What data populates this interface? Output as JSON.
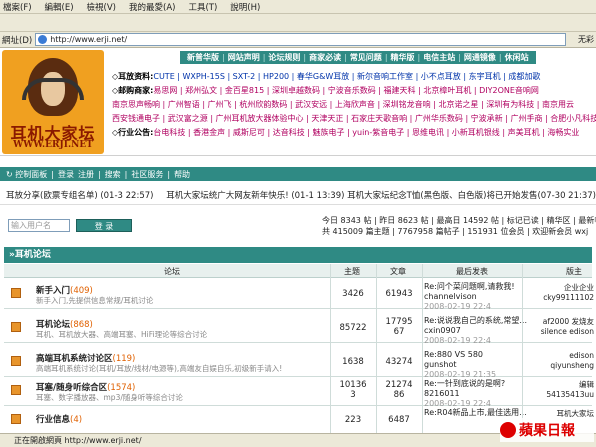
{
  "browser": {
    "menu": [
      "檔案(F)",
      "編輯(E)",
      "檢視(V)",
      "我的最愛(A)",
      "工具(T)",
      "說明(H)"
    ],
    "address_label": "網址(D)",
    "address_value": "http://www.erji.net/",
    "address_right": "无彩",
    "status_text": "正在開啟網頁 http://www.erji.net/"
  },
  "logo": {
    "title": "耳机大家坛",
    "url": "WWW.ERJI.NET"
  },
  "top_nav": [
    "新普华版",
    "网站声明",
    "论坛规则",
    "商家必读",
    "常见问题",
    "精华版",
    "电信主站",
    "网通镜像",
    "休闲站"
  ],
  "links_rows": [
    {
      "tag": "◇耳放资料:",
      "text": "CUTE | WXPH-15S | SXT-2 | HP200 | 春华G&W耳放 | 新尔音响工作室 | 小不点耳放 | 东宇耳机 | 成都加歌"
    },
    {
      "tag": "◇邮购商家:",
      "text": "易思网 | 郑州弘文 | 金百星815 | 深圳卓越数码 | 宁波音乐数码 | 福建天科 | 北京樟叶耳机 | DIY2ONE音响网"
    },
    {
      "tag": "",
      "text": "南京思声畅响 | 广州智语 | 广州飞 | 杭州欣韵数码 | 武汉安远 | 上海欣声音 | 深圳铭龙音响 | 北京诺之星 | 深圳有为科技 | 南京用云"
    },
    {
      "tag": "",
      "text": "西安钱通电子 | 武汉富之源 | 广州耳机放大器体验中心 | 天津天正 | 石家庄天歌音响 | 广州华乐数码 | 宁波承新 | 广州手商 | 合肥小凡科技"
    },
    {
      "tag": "◇行业公告:",
      "text": "台电科技 | 香港金声 | 威斯尼可 | 达音科技 | 魅族电子 | yuin-紫音电子 | 恩维电讯 | 小新耳机银线 | 声美耳机 | 海畅实业"
    }
  ],
  "sub_nav": [
    "↻ 控制面板",
    "|",
    "登录",
    "注册",
    "|",
    "搜索",
    "|",
    "社区服务",
    "|",
    "帮助"
  ],
  "announce": {
    "left": "耳放分享(欧票专组名单) (01-3 22:57)",
    "right": "耳机大家坛统广大网友新年快乐! (01-1 13:39)    耳机大家坛纪念T恤(黑色版、白色版)将已开始发售(07-30 21:37)"
  },
  "login": {
    "placeholder": "输入用户名",
    "button": "登 录"
  },
  "stats": {
    "line1": "今日 8343 帖 | 昨日 8623 帖 | 最高日 14592 帖 | 标记已读 | 精华区 | 最新帖子",
    "line2": "共 415009 篇主题 | 7767958 篇帖子 | 151931 位会员 | 欢迎新会员 wxj"
  },
  "forum": {
    "section_title": "»耳机论坛",
    "headers": {
      "forum": "论坛",
      "topics": "主题",
      "posts": "文章",
      "last": "最后发表",
      "mod": "版主"
    },
    "rows": [
      {
        "name": "新手入门",
        "count": "(409)",
        "desc": "新手入门,先提供信息常规/耳机讨论",
        "topics": "3426",
        "posts": "61943",
        "last_title": "Re:问个菜问题啊,请救我!",
        "last_user": "channelvison",
        "last_date": "2008-02-19 22:4",
        "mod": "企业企业\ncky99111102"
      },
      {
        "name": "耳机论坛",
        "count": "(868)",
        "desc": "耳机、耳机放大器、高端耳塞、HiFi理论等综合讨论",
        "topics": "85722",
        "posts": "17795\n67",
        "last_title": "Re:说说我自己的系统,常望...",
        "last_user": "cxin0907",
        "last_date": "2008-02-19 22:4",
        "mod": "af2000 发烧友\nsilence edison"
      },
      {
        "name": "高端耳机系统讨论区",
        "count": "(119)",
        "desc": "高端耳机系统讨论(耳机/耳放/线材/电源等),高端友自娱自乐,初级新手请入!",
        "topics": "1638",
        "posts": "43274",
        "last_title": "Re:880 VS 580",
        "last_user": "gunshot",
        "last_date": "2008-02-19 21:35",
        "mod": "edison\nqiyunsheng"
      },
      {
        "name": "耳塞/随身听综合区",
        "count": "(1574)",
        "desc": "耳塞、数字播放器、mp3/随身听等综合讨论",
        "topics": "10136\n3",
        "posts": "21274\n86",
        "last_title": "Re:一针到底说的是啊?",
        "last_user": "8216011",
        "last_date": "2008-02-19 22:4",
        "mod": "编辑\n54135413uu"
      },
      {
        "name": "行业信息",
        "count": "(4)",
        "desc": "",
        "topics": "223",
        "posts": "6487",
        "last_title": "Re:R04新品上市,最佳选用...",
        "last_user": "",
        "last_date": "",
        "mod": "耳机大家坛"
      }
    ]
  },
  "watermark": "蘋果日報"
}
